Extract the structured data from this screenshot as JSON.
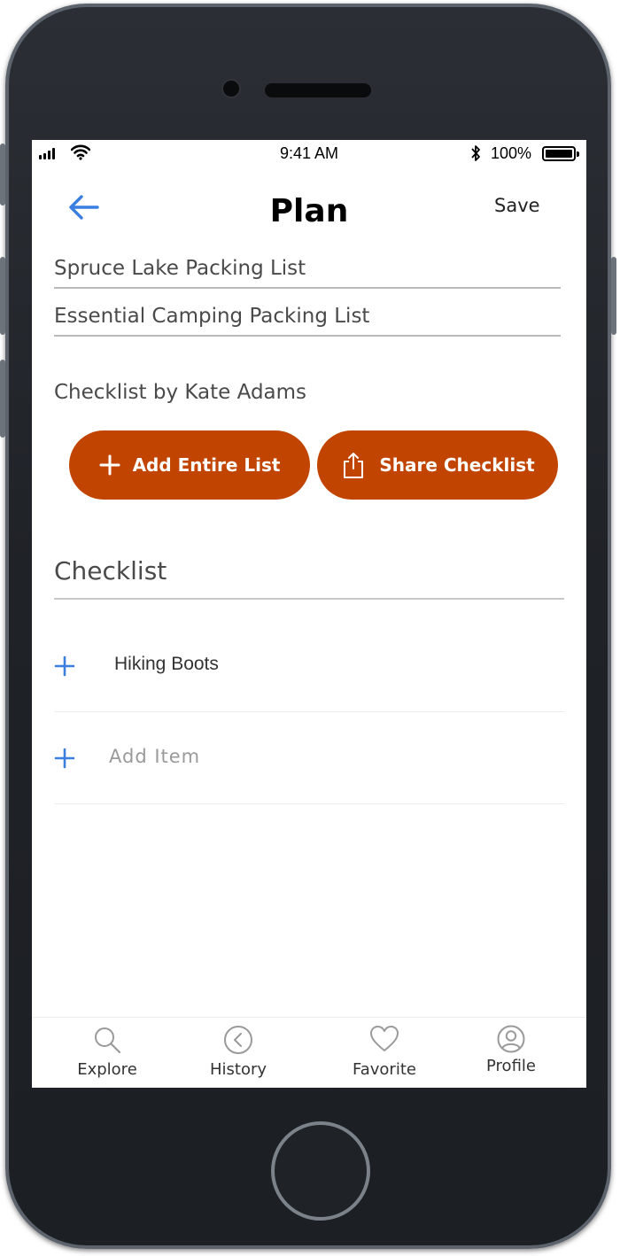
{
  "status_bar": {
    "time": "9:41 AM",
    "battery_percent": "100%"
  },
  "nav": {
    "title": "Plan",
    "save_label": "Save",
    "back_icon": "back-arrow-icon"
  },
  "list": {
    "name": "Spruce Lake Packing List",
    "description": "Essential Camping Packing List",
    "author_line": "Checklist by Kate Adams"
  },
  "actions": {
    "add_entire_list": "Add Entire List",
    "share_checklist": "Share Checklist"
  },
  "checklist": {
    "heading": "Checklist",
    "items": [
      {
        "label": "Hiking Boots"
      }
    ],
    "add_item_placeholder": "Add  Item"
  },
  "tabs": [
    {
      "label": "Explore",
      "icon": "search-icon"
    },
    {
      "label": "History",
      "icon": "history-icon"
    },
    {
      "label": "Favorite",
      "icon": "heart-icon"
    },
    {
      "label": "Profile",
      "icon": "profile-icon"
    }
  ],
  "colors": {
    "accent_orange": "#c14500",
    "link_blue": "#3a7fe0",
    "text_gray": "#4a4a4a"
  }
}
